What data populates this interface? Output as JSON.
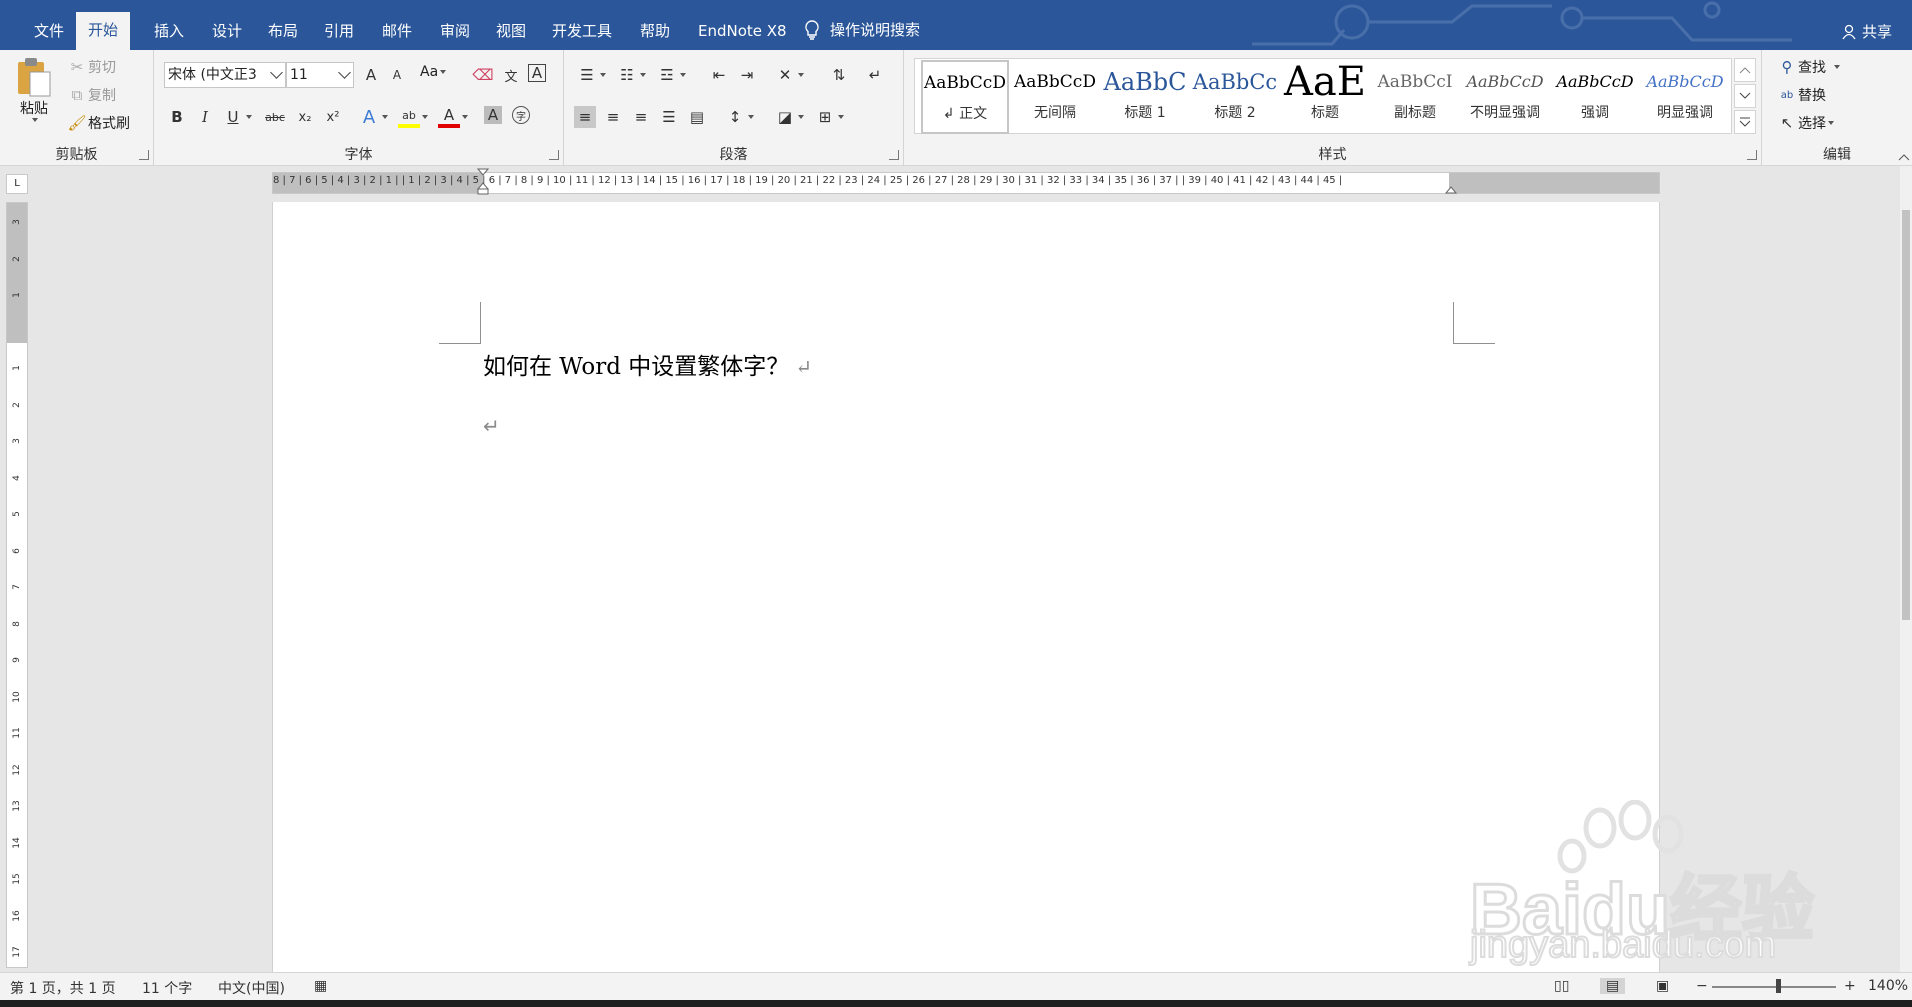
{
  "tabs": [
    "文件",
    "开始",
    "插入",
    "设计",
    "布局",
    "引用",
    "邮件",
    "审阅",
    "视图",
    "开发工具",
    "帮助",
    "EndNote X8"
  ],
  "active_tab": "开始",
  "tell_me": "操作说明搜索",
  "share": "共享",
  "clipboard": {
    "label": "剪贴板",
    "paste": "粘贴",
    "cut": "剪切",
    "copy": "复制",
    "format_painter": "格式刷"
  },
  "font": {
    "label": "字体",
    "name": "宋体 (中文正3",
    "size": "11",
    "grow": "A",
    "shrink": "A",
    "change_case": "Aa",
    "bold": "B",
    "italic": "I",
    "underline": "U",
    "strikethrough": "abc",
    "subscript": "x₂",
    "superscript": "x²",
    "text_effects": "A",
    "highlight": "ab",
    "font_color": "A",
    "char_shading": "A",
    "enclose": "字"
  },
  "paragraph": {
    "label": "段落"
  },
  "styles": {
    "label": "样式",
    "items": [
      {
        "preview": "AaBbCcD",
        "name": "↲ 正文"
      },
      {
        "preview": "AaBbCcD",
        "name": "无间隔"
      },
      {
        "preview": "AaBbC",
        "name": "标题 1"
      },
      {
        "preview": "AaBbCc",
        "name": "标题 2"
      },
      {
        "preview": "AaE",
        "name": "标题"
      },
      {
        "preview": "AaBbCcI",
        "name": "副标题"
      },
      {
        "preview": "AaBbCcD",
        "name": "不明显强调"
      },
      {
        "preview": "AaBbCcD",
        "name": "强调"
      },
      {
        "preview": "AaBbCcD",
        "name": "明显强调"
      }
    ]
  },
  "editing": {
    "label": "编辑",
    "find": "查找",
    "replace": "替换",
    "select": "选择"
  },
  "ruler": {
    "numbers": "8 | 7 | 6 | 5 | 4 | 3 | 2 | 1 |   | 1 | 2 | 3 | 4 | 5 | 6 | 7 | 8 | 9 | 10 | 11 | 12 | 13 | 14 | 15 | 16 | 17 | 18 | 19 | 20 | 21 | 22 | 23 | 24 | 25 | 26 | 27 | 28 | 29 | 30 | 31 | 32 | 33 | 34 | 35 | 36 | 37 |   | 39 | 40 | 41 | 42 | 43 | 44 | 45 |",
    "vertical": [
      "3",
      "2",
      "1",
      "",
      "1",
      "2",
      "3",
      "4",
      "5",
      "6",
      "7",
      "8",
      "9",
      "10",
      "11",
      "12",
      "13",
      "14",
      "15",
      "16",
      "17"
    ]
  },
  "document": {
    "line1": "如何在 Word 中设置繁体字？",
    "pilcrow": "↵"
  },
  "status": {
    "page": "第 1 页，共 1 页",
    "words": "11 个字",
    "language": "中文(中国)",
    "zoom": "140%",
    "zoom_minus": "−",
    "zoom_plus": "+"
  },
  "watermark": {
    "brand": "Baidu经验",
    "url": "jingyan.baidu.com"
  },
  "colors": {
    "ribbon_blue": "#2b579a",
    "highlight": "#ffff00",
    "font_red": "#e00000"
  }
}
